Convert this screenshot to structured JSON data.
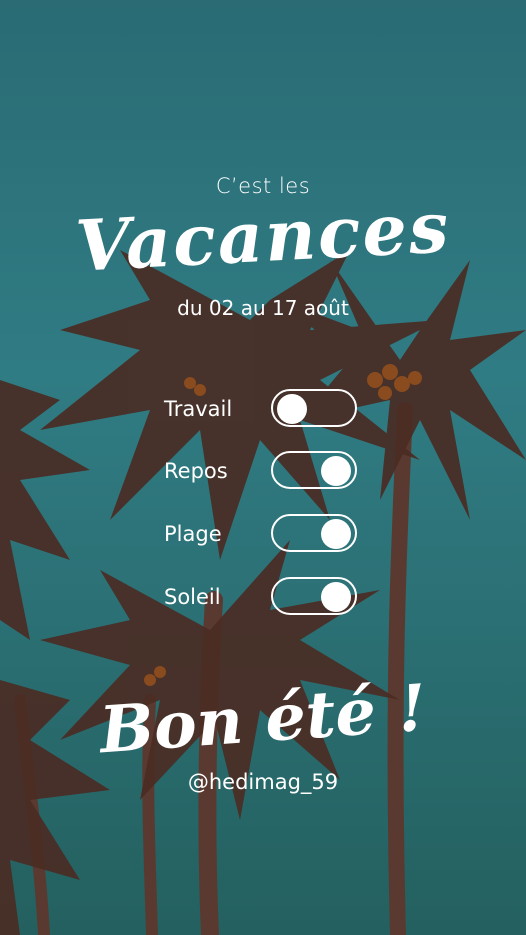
{
  "header": {
    "pre_title": "C’est les",
    "title": "Vacances",
    "dates": "du 02 au 17 août"
  },
  "toggles": [
    {
      "label": "Travail",
      "on": false
    },
    {
      "label": "Repos",
      "on": true
    },
    {
      "label": "Plage",
      "on": true
    },
    {
      "label": "Soleil",
      "on": true
    }
  ],
  "footer": {
    "greeting": "Bon été !",
    "handle": "@hedimag_59"
  },
  "colors": {
    "sky": "#2d737b",
    "palm": "#4a2d24",
    "text": "#ffffff"
  }
}
